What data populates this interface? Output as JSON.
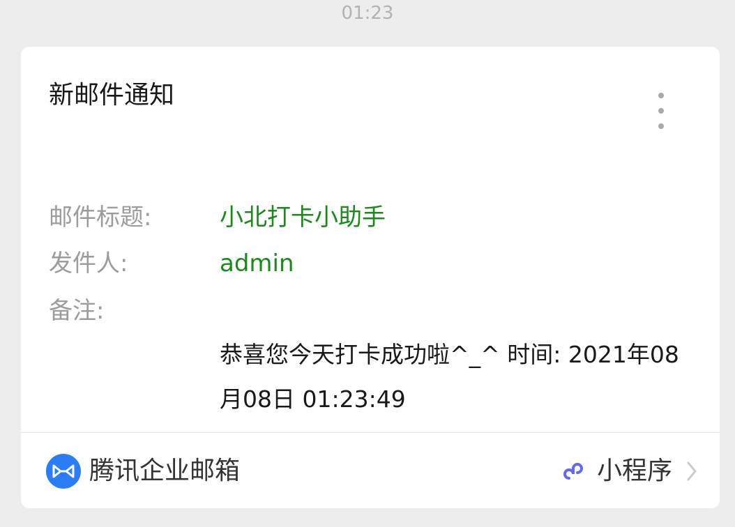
{
  "chat": {
    "timestamp": "01:23"
  },
  "card": {
    "title": "新邮件通知",
    "more_icon": "more-vertical-icon",
    "fields": {
      "subject_label": "邮件标题:",
      "subject_value": "小北打卡小助手",
      "sender_label": "发件人:",
      "sender_value": "admin",
      "remark_label": "备注:",
      "remark_value": "恭喜您今天打卡成功啦^_^ 时间: 2021年08月08日 01:23:49"
    },
    "footer": {
      "source_name": "腾讯企业邮箱",
      "source_icon": "tencent-exmail-icon",
      "mini_program_label": "小程序",
      "mini_program_icon": "mini-program-icon",
      "chevron_icon": "chevron-right-icon"
    }
  },
  "colors": {
    "value_green": "#1a8a1a",
    "label_gray": "#9c9c9c",
    "brand_blue": "#2b7cf7",
    "mini_program_purple": "#6467f0",
    "background": "#ededed"
  }
}
